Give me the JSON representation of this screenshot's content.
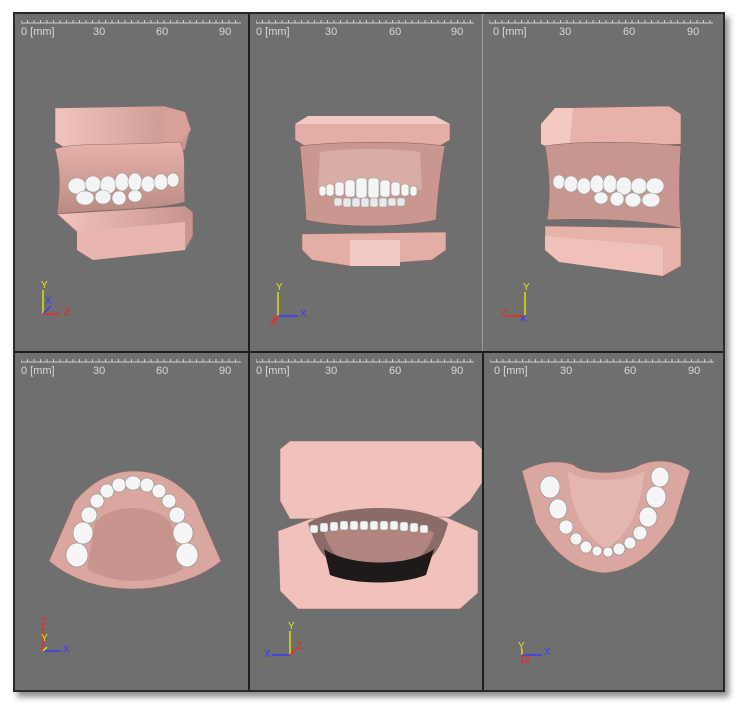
{
  "ruler": {
    "label_0": "0 [mm]",
    "label_30": "30",
    "label_60": "60",
    "label_90": "90"
  },
  "axis_colors": {
    "x": "#3a3aff",
    "y": "#e8e800",
    "z": "#ff2020"
  },
  "viewports": [
    {
      "name": "right-view",
      "axes": {
        "a": "Y",
        "b": "X",
        "c": "Z"
      }
    },
    {
      "name": "front-view",
      "axes": {
        "a": "Y",
        "b": "X",
        "c": "Z"
      }
    },
    {
      "name": "left-view",
      "axes": {
        "a": "Y",
        "b": "X",
        "c": "Z"
      }
    },
    {
      "name": "top-view",
      "axes": {
        "a": "Z",
        "b": "X",
        "c": "Y"
      }
    },
    {
      "name": "back-view",
      "axes": {
        "a": "Y",
        "b": "X",
        "c": "Z"
      }
    },
    {
      "name": "bottom-view",
      "axes": {
        "a": "Y",
        "b": "X",
        "c": "Z"
      }
    }
  ]
}
